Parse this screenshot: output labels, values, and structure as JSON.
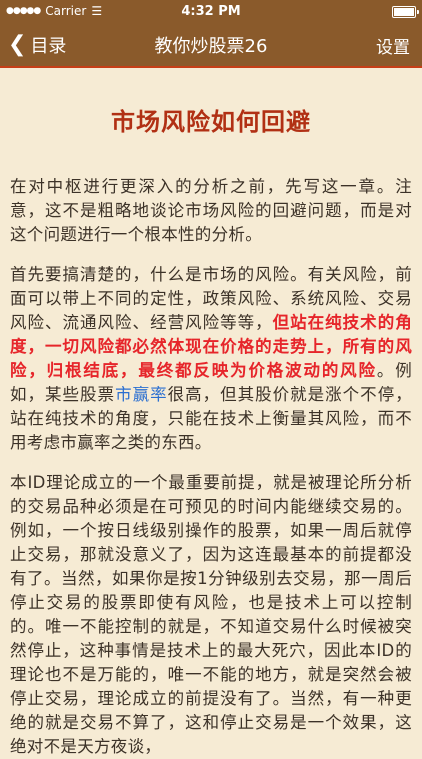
{
  "status": {
    "carrier": "Carrier",
    "time": "4:32 PM"
  },
  "nav": {
    "back_label": "目录",
    "title": "教你炒股票26",
    "settings_label": "设置"
  },
  "article": {
    "title": "市场风险如何回避",
    "p1": "在对中枢进行更深入的分析之前，先写这一章。注意，这不是粗略地谈论市场风险的回避问题，而是对这个问题进行一个根本性的分析。",
    "p2a": "首先要搞清楚的，什么是市场的风险。有关风险，前面可以带上不同的定性，政策风险、系统风险、交易风险、流通风险、经营风险等等，",
    "p2b": "但站在纯技术的角度，一切风险都必然体现在价格的走势上，所有的风险，归根结底，最终都反映为价格波动的风险",
    "p2c": "。例如，某些股票",
    "p2d": "市赢率",
    "p2e": "很高，但其股价就是涨个不停，站在纯技术的角度，只能在技术上衡量其风险，而不用考虑市赢率之类的东西。",
    "p3": "本ID理论成立的一个最重要前提，就是被理论所分析的交易品种必须是在可预见的时间内能继续交易的。例如，一个按日线级别操作的股票，如果一周后就停止交易，那就没意义了，因为这连最基本的前提都没有了。当然，如果你是按1分钟级别去交易，那一周后停止交易的股票即使有风险，也是技术上可以控制的。唯一不能控制的就是，不知道交易什么时候被突然停止，这种事情是技术上的最大死穴，因此本ID的理论也不是万能的，唯一不能的地方，就是突然会被停止交易，理论成立的前提没有了。当然，有一种更绝的就是交易不算了，这和停止交易是一个效果，这绝对不是天方夜谈，"
  }
}
